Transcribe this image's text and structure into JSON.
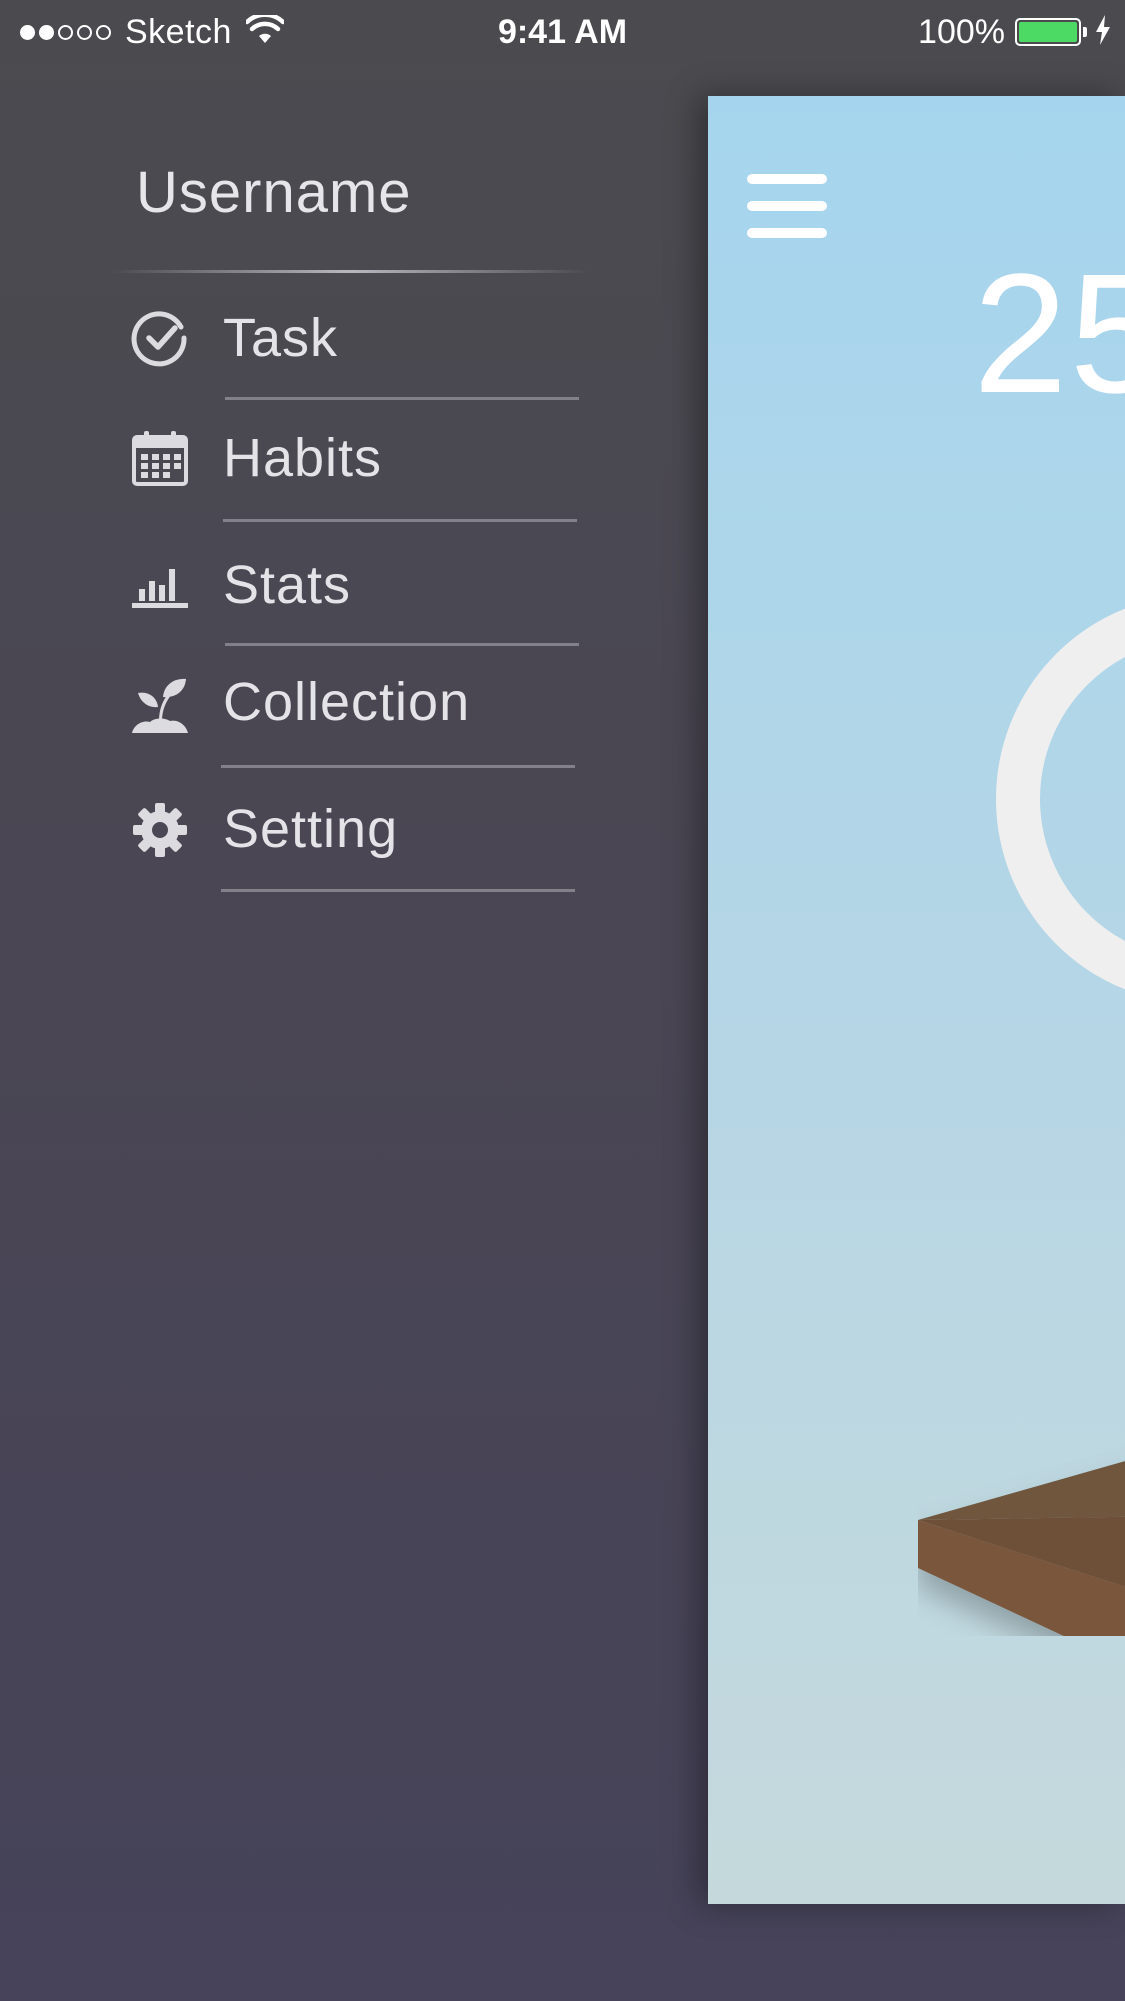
{
  "status_bar": {
    "carrier": "Sketch",
    "time": "9:41 AM",
    "battery_percent": "100%",
    "signal_strength": 2,
    "signal_total": 5,
    "battery_level": 1.0,
    "battery_color": "#4cd964"
  },
  "side_menu": {
    "username": "Username",
    "items": [
      {
        "label": "Task",
        "icon": "check-circle-icon"
      },
      {
        "label": "Habits",
        "icon": "calendar-icon"
      },
      {
        "label": "Stats",
        "icon": "bar-chart-icon"
      },
      {
        "label": "Collection",
        "icon": "sprout-icon"
      },
      {
        "label": "Setting",
        "icon": "gear-icon"
      }
    ]
  },
  "main": {
    "timer_text": "25",
    "menu_icon": "hamburger-icon",
    "background_top": "#a5d5ee",
    "background_bottom": "#c5d9dc"
  }
}
